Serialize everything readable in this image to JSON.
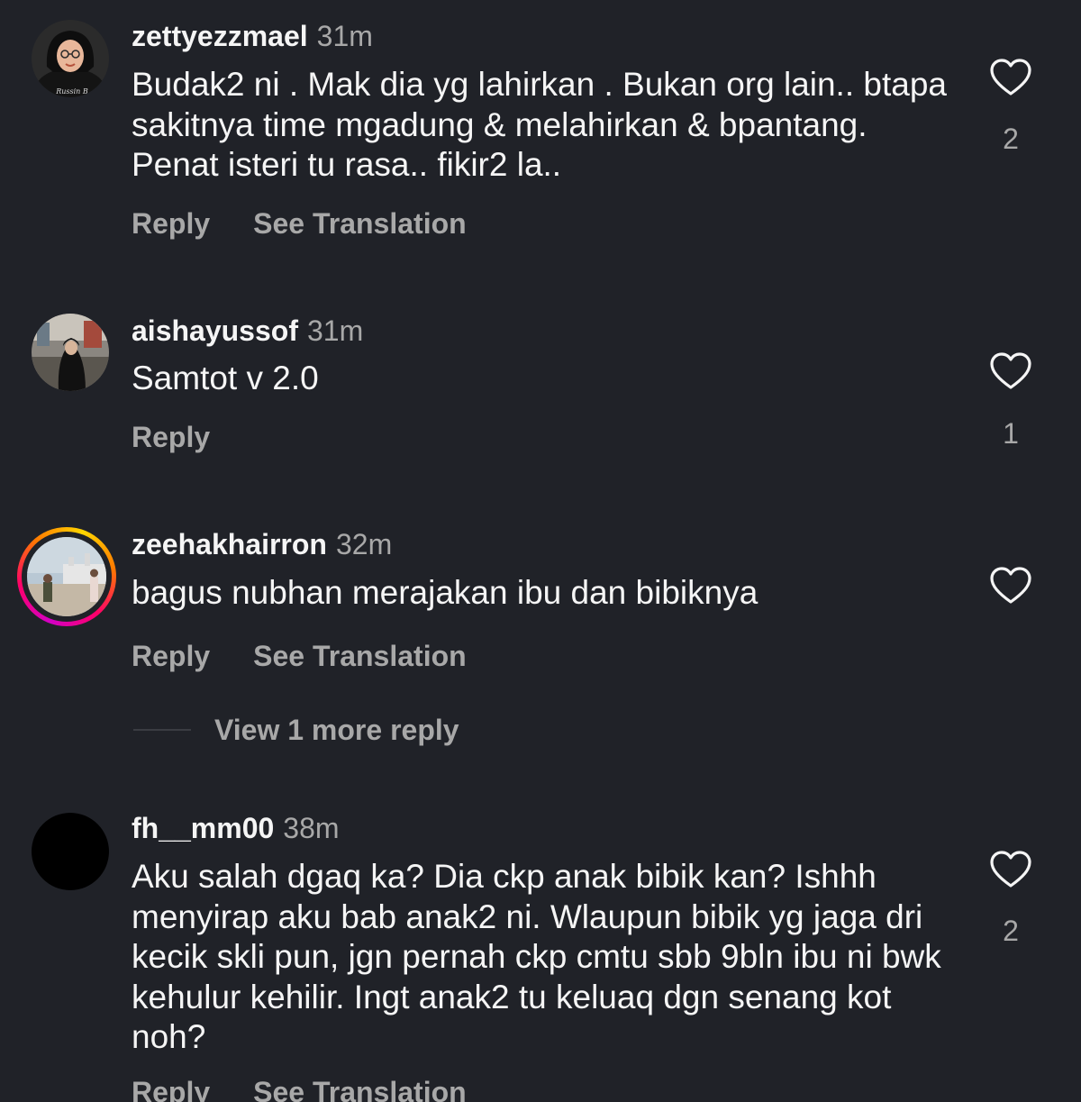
{
  "comments": [
    {
      "username": "zettyezzmael",
      "time": "31m",
      "text": "Budak2 ni . Mak dia yg lahirkan . Bukan org lain.. btapa sakitnya time mgadung & melahirkan & bpantang. Penat isteri tu rasa.. fikir2 la..",
      "reply_label": "Reply",
      "translate_label": "See Translation",
      "likes": "2",
      "avatar_caption": "Russin B"
    },
    {
      "username": "aishayussof",
      "time": "31m",
      "text": "Samtot v 2.0",
      "reply_label": "Reply",
      "likes": "1"
    },
    {
      "username": "zeehakhairron",
      "time": "32m",
      "text": "bagus nubhan merajakan ibu dan bibiknya",
      "reply_label": "Reply",
      "translate_label": "See Translation",
      "has_story": true,
      "view_replies_label": "View 1 more reply"
    },
    {
      "username": "fh__mm00",
      "time": "38m",
      "text": "Aku salah dgaq ka? Dia ckp anak bibik kan? Ishhh menyirap aku bab anak2 ni. Wlaupun bibik yg jaga dri kecik skli pun, jgn pernah ckp cmtu sbb 9bln ibu ni bwk kehulur kehilir. Ingt anak2 tu keluaq dgn senang kot noh?",
      "reply_label": "Reply",
      "translate_label": "See Translation",
      "likes": "2"
    }
  ],
  "colors": {
    "background": "#202228",
    "primary_text": "#f5f5f5",
    "secondary_text": "#a8a8a8"
  },
  "icons": {
    "like": "heart-outline-icon"
  }
}
